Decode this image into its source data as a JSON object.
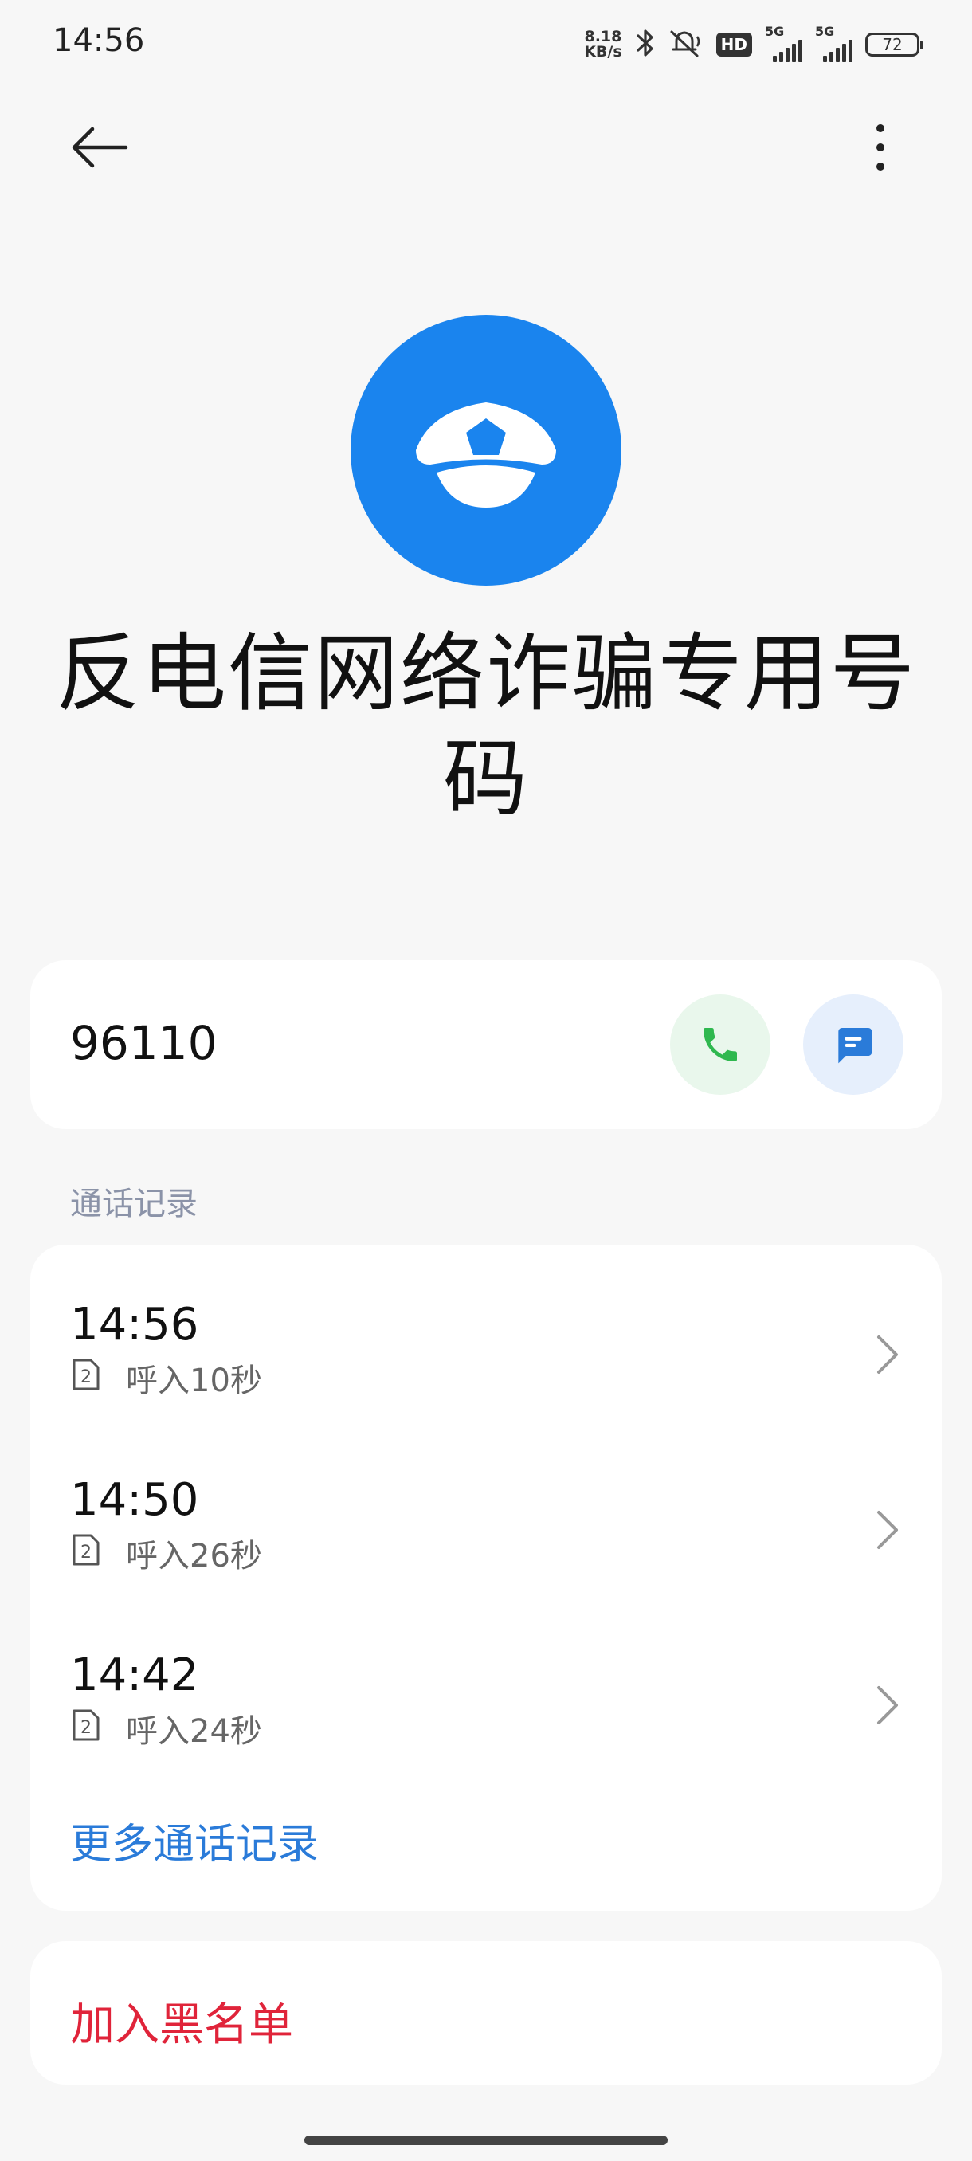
{
  "status_bar": {
    "time": "14:56",
    "net_speed_value": "8.18",
    "net_speed_unit": "KB/s",
    "hd_label": "HD",
    "signal1_label": "5G",
    "signal2_label": "5G",
    "battery": "72",
    "icons": [
      "bluetooth-icon",
      "mute-icon"
    ]
  },
  "nav": {
    "back_icon": "arrow-left-icon",
    "more_icon": "more-vertical-icon"
  },
  "contact": {
    "avatar_icon": "police-cap-icon",
    "avatar_color": "#1a84ee",
    "name": "反电信网络诈骗专用号码",
    "number": "96110",
    "call_icon": "phone-icon",
    "message_icon": "message-icon"
  },
  "history": {
    "section_label": "通话记录",
    "calls": [
      {
        "time": "14:56",
        "sim": "2",
        "desc": "呼入10秒"
      },
      {
        "time": "14:50",
        "sim": "2",
        "desc": "呼入26秒"
      },
      {
        "time": "14:42",
        "sim": "2",
        "desc": "呼入24秒"
      }
    ],
    "more_label": "更多通话记录"
  },
  "actions": {
    "blacklist_label": "加入黑名单",
    "blacklist_color": "#e0243a",
    "accent_color": "#2a7bd9"
  }
}
